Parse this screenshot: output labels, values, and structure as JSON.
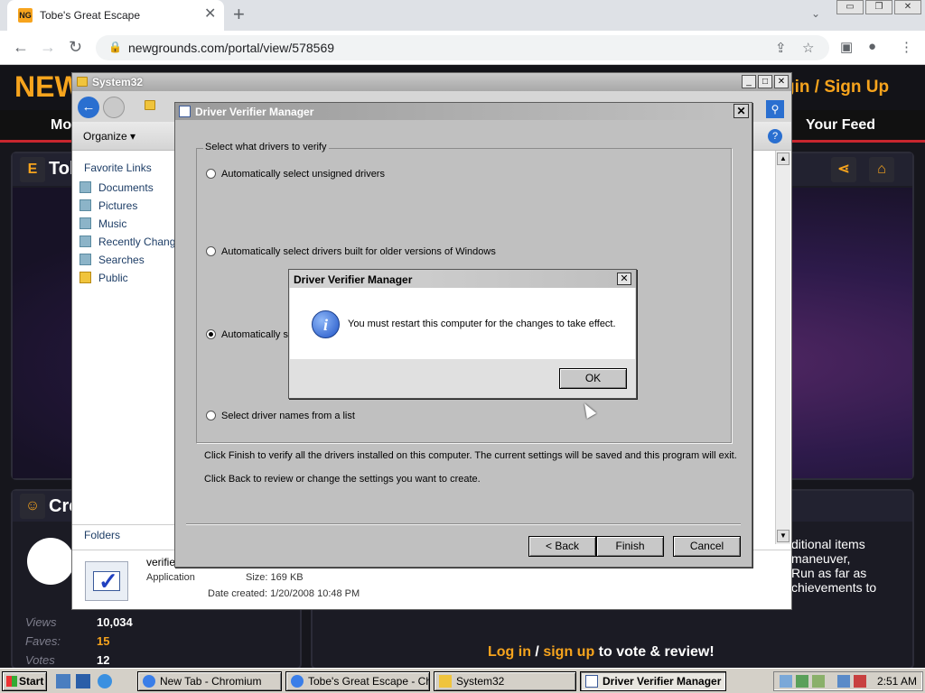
{
  "browser": {
    "tab_title": "Tobe's Great Escape",
    "tab_favicon_text": "NG",
    "close_glyph": "✕",
    "newtab_glyph": "+",
    "url": "newgrounds.com/portal/view/578569",
    "back_glyph": "←",
    "forward_glyph": "→",
    "reload_glyph": "↻",
    "lock_glyph": "🔒",
    "share_glyph": "⇪",
    "star_glyph": "☆",
    "sidepanel_glyph": "▣",
    "profile_glyph": "●",
    "menu_glyph": "⋮",
    "tab_dropdown_glyph": "⌄",
    "window_controls": [
      "▭",
      "❐",
      "✕"
    ]
  },
  "newgrounds": {
    "logo": "NEW",
    "login": "gin / Sign Up",
    "nav_left": "Mo",
    "nav_right": "Your Feed",
    "title_fragment": "Tob",
    "section_fragment": "Cre",
    "stats": [
      {
        "label": "Views",
        "value": "10,034",
        "accent": false
      },
      {
        "label": "Faves:",
        "value": "15",
        "accent": true
      },
      {
        "label": "Votes",
        "value": "12",
        "accent": false
      }
    ],
    "description_lines": [
      "ditional items",
      "maneuver,",
      "Run as far as",
      "chievements to"
    ],
    "vote_link1": "Log in",
    "vote_sep": " / ",
    "vote_link2": "sign up",
    "vote_rest": " to vote & review!"
  },
  "explorer": {
    "title": "System32",
    "organize": "Organize",
    "favorite_links_header": "Favorite Links",
    "favorite_links": [
      {
        "label": "Documents",
        "icon": "documents-icon"
      },
      {
        "label": "Pictures",
        "icon": "pictures-icon"
      },
      {
        "label": "Music",
        "icon": "music-icon"
      },
      {
        "label": "Recently Changed",
        "icon": "recent-icon"
      },
      {
        "label": "Searches",
        "icon": "searches-icon"
      },
      {
        "label": "Public",
        "icon": "folder-icon"
      }
    ],
    "folders_label": "Folders",
    "details": {
      "name": "verifie",
      "type": "Application",
      "size_label": "Size:",
      "size": "169 KB",
      "date_label": "Date created:",
      "date": "1/20/2008 10:48 PM"
    }
  },
  "driver_verifier": {
    "title": "Driver Verifier Manager",
    "group_label": "Select what drivers to verify",
    "options": [
      {
        "label": "Automatically select unsigned drivers",
        "selected": false
      },
      {
        "label": "Automatically select drivers built for older versions of Windows",
        "selected": false
      },
      {
        "label": "Automatically se",
        "selected": true
      },
      {
        "label": "Select driver names from a list",
        "selected": false
      }
    ],
    "info_line1": "Click Finish to verify all the drivers installed on this computer. The current settings will be saved and this program will exit.",
    "info_line2": "Click Back to review or change the settings you want to create.",
    "back_button": "< Back",
    "finish_button": "Finish",
    "cancel_button": "Cancel"
  },
  "message_box": {
    "title": "Driver Verifier Manager",
    "message": "You must restart this computer for the changes to take effect.",
    "ok_button": "OK",
    "icon_glyph": "i"
  },
  "taskbar": {
    "start": "Start",
    "tasks": [
      {
        "label": "New Tab - Chromium",
        "active": false
      },
      {
        "label": "Tobe's Great Escape - Ch...",
        "active": false
      },
      {
        "label": "System32",
        "active": false
      },
      {
        "label": "Driver Verifier Manager",
        "active": true
      }
    ],
    "clock": "2:51 AM"
  }
}
